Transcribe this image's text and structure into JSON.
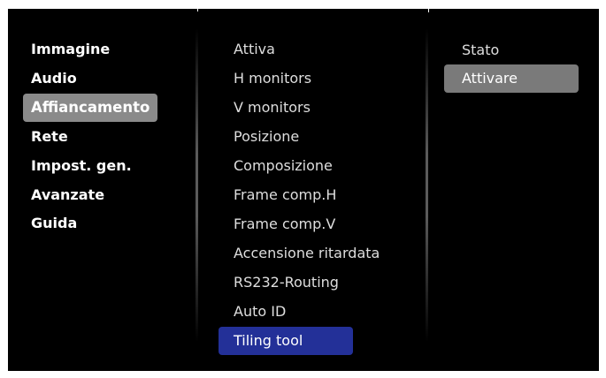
{
  "main_menu": {
    "items": [
      {
        "label": "Immagine"
      },
      {
        "label": "Audio"
      },
      {
        "label": "Affiancamento"
      },
      {
        "label": "Rete"
      },
      {
        "label": "Impost. gen."
      },
      {
        "label": "Avanzate"
      },
      {
        "label": "Guida"
      }
    ],
    "selected_label": "Affiancamento"
  },
  "tiling_menu": {
    "items": [
      {
        "label": "Attiva"
      },
      {
        "label": "H monitors"
      },
      {
        "label": "V monitors"
      },
      {
        "label": "Posizione"
      },
      {
        "label": "Composizione"
      },
      {
        "label": "Frame comp.H"
      },
      {
        "label": "Frame comp.V"
      },
      {
        "label": "Accensione ritardata"
      },
      {
        "label": "RS232-Routing"
      },
      {
        "label": "Auto ID"
      },
      {
        "label": "Tiling tool"
      }
    ],
    "focused_label": "Tiling tool"
  },
  "options_menu": {
    "items": [
      {
        "label": "Stato"
      },
      {
        "label": "Attivare"
      }
    ],
    "selected_label": "Attivare"
  },
  "colors": {
    "background": "#000000",
    "selected_main": "#8a8a8a",
    "focused_sub": "#233098",
    "selected_option": "#7a7a7a",
    "text": "#ffffff"
  }
}
